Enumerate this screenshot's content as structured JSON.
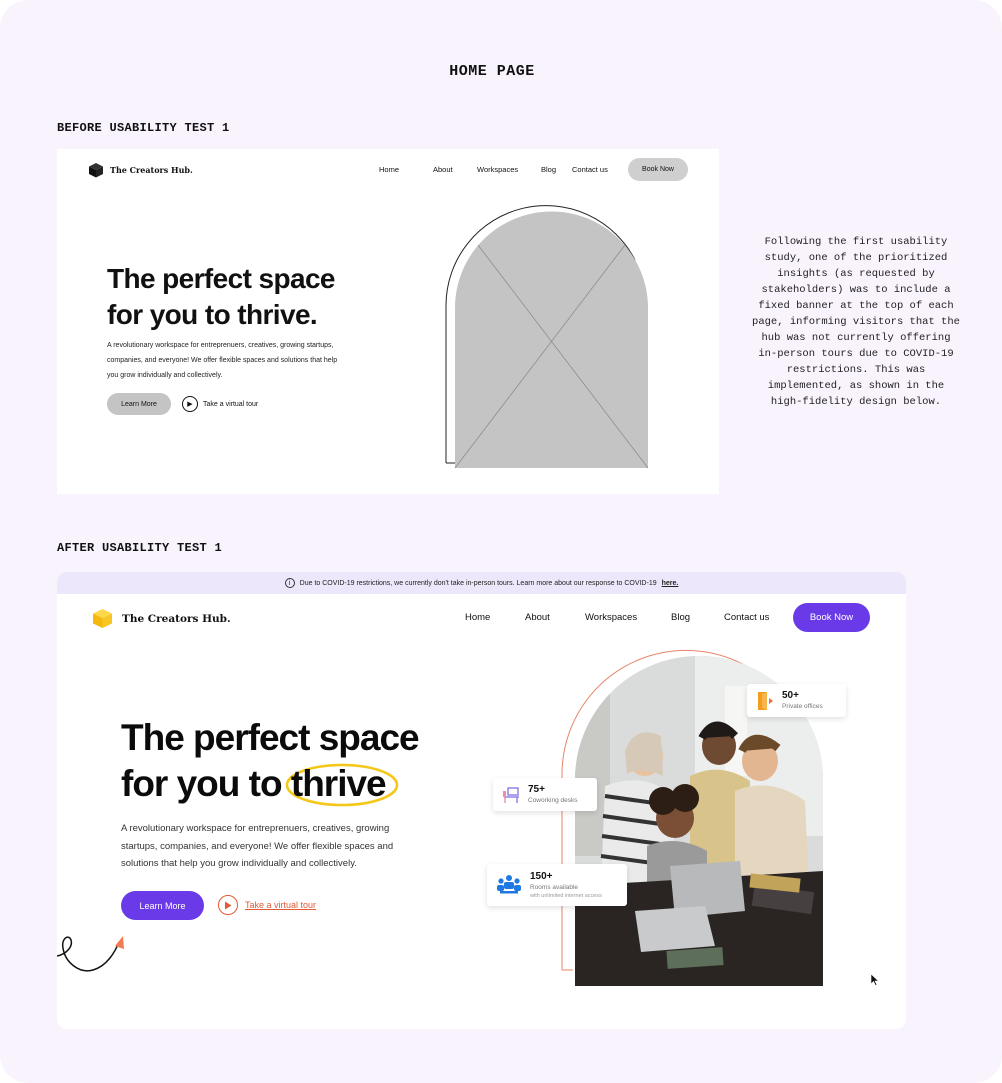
{
  "page_title": "HOME PAGE",
  "sections": {
    "before_label": "BEFORE USABILITY TEST 1",
    "after_label": "AFTER USABILITY TEST 1"
  },
  "note": "Following the first usability study, one of the prioritized insights (as requested by stakeholders) was to include a fixed banner at the top of each page, informing visitors that the hub was not currently offering in-person tours due to COVID-19 restrictions. This was implemented, as shown in the high-fidelity design below.",
  "wireframe": {
    "brand": "The Creators Hub.",
    "nav": [
      "Home",
      "About",
      "Workspaces",
      "Blog",
      "Contact us"
    ],
    "book_now": "Book Now",
    "heading_line1": "The perfect space",
    "heading_line2": "for you to thrive.",
    "paragraph": "A revolutionary workspace for entreprenuers, creatives, growing startups, companies, and everyone! We offer flexible spaces and solutions that help you grow individually and collectively.",
    "learn_more": "Learn More",
    "virtual_tour": "Take a virtual tour"
  },
  "hifi": {
    "banner_text": "Due to COVID-19 restrictions, we currently don't take in-person tours. Learn more about our response to COVID-19",
    "banner_link": "here.",
    "brand": "The Creators Hub.",
    "nav": [
      "Home",
      "About",
      "Workspaces",
      "Blog",
      "Contact us"
    ],
    "book_now": "Book Now",
    "heading_line1": "The perfect space",
    "heading_line2_prefix": "for you to",
    "heading_highlight": "thrive",
    "paragraph": "A revolutionary workspace for entreprenuers, creatives, growing startups, companies, and everyone! We offer flexible spaces and solutions that help you grow individually and collectively.",
    "learn_more": "Learn More",
    "virtual_tour": "Take a virtual tour",
    "stats": {
      "private_offices": {
        "number": "50+",
        "label": "Private offices",
        "icon": "door-icon"
      },
      "coworking_desks": {
        "number": "75+",
        "label": "Coworking desks",
        "icon": "desk-icon"
      },
      "rooms": {
        "number": "150+",
        "label": "Rooms available",
        "sub": "with unlimited internet access",
        "icon": "meeting-room-icon"
      }
    },
    "colors": {
      "accent": "#6a3ae8",
      "banner_bg": "#ece7fa",
      "tour_link": "#e25a36",
      "highlight": "#f4c81a",
      "logo_cube": "#f7c21c"
    }
  }
}
